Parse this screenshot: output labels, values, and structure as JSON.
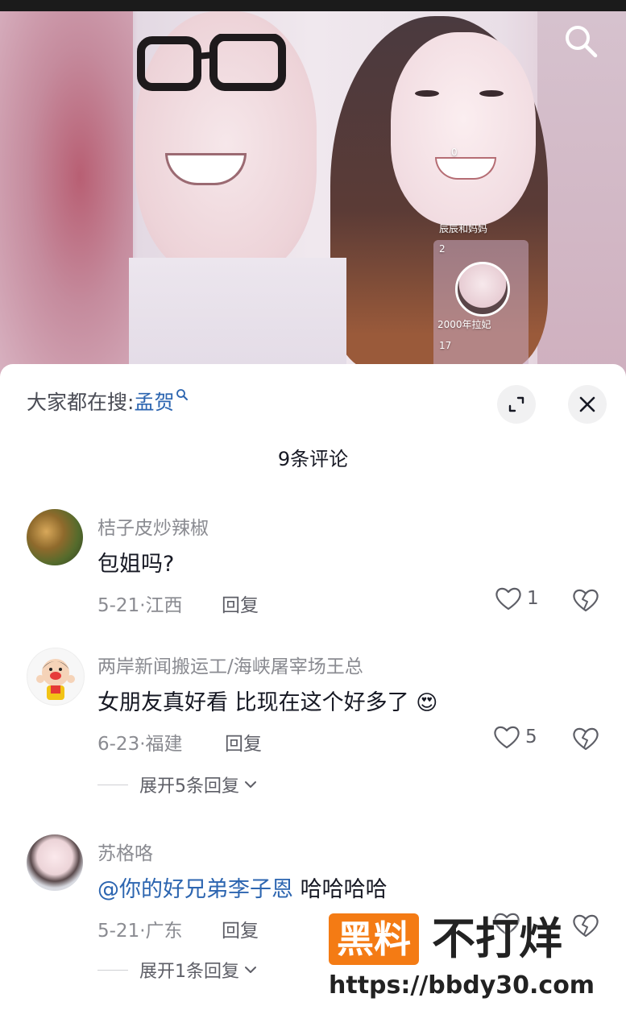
{
  "video": {
    "overlay_top": "0",
    "overlay_label_1": "辰辰和妈妈",
    "overlay_count_1": "2",
    "overlay_label_2": "2000年拉妃",
    "overlay_count_2": "17"
  },
  "header": {
    "trend_prefix": "大家都在搜:",
    "trend_keyword": "孟贺",
    "comment_count": "9条评论"
  },
  "comments": [
    {
      "username": "桔子皮炒辣椒",
      "text": "包姐吗?",
      "meta": "5-21·江西",
      "reply_label": "回复",
      "likes": "1"
    },
    {
      "username": "两岸新闻搬运工/海峡屠宰场王总",
      "text": "女朋友真好看 比现在这个好多了",
      "emoji": "😍",
      "meta": "6-23·福建",
      "reply_label": "回复",
      "likes": "5",
      "expand_label": "展开5条回复"
    },
    {
      "username": "苏格咯",
      "mention": "@你的好兄弟李子恩",
      "text": " 哈哈哈哈",
      "meta": "5-21·广东",
      "reply_label": "回复",
      "likes": "",
      "expand_label": "展开1条回复"
    }
  ],
  "watermark": {
    "badge": "黑料",
    "tail": "不打烊",
    "url": "https://bbdy30.com"
  },
  "colors": {
    "mention_blue": "#2c65b0",
    "watermark_orange": "#f47b14"
  },
  "icons": [
    "search-icon",
    "expand-icon",
    "close-icon",
    "heart-icon",
    "broken-heart-icon",
    "chevron-down-icon"
  ]
}
